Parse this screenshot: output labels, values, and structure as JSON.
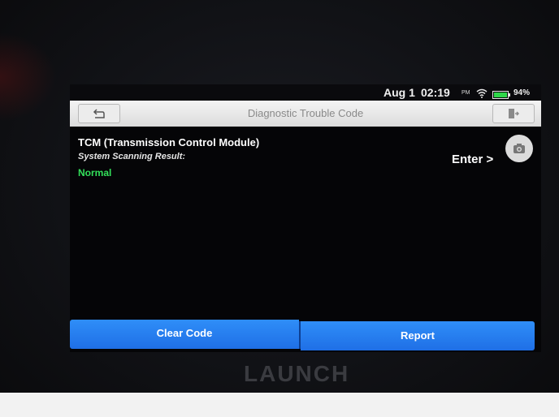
{
  "status_bar": {
    "date": "Aug 1",
    "time": "02:19",
    "ampm": "PM",
    "battery": "94%"
  },
  "header": {
    "title": "Diagnostic Trouble Code"
  },
  "module": {
    "name": "TCM (Transmission Control Module)",
    "scan_label": "System Scanning Result:",
    "status": "Normal",
    "enter_label": "Enter >"
  },
  "footer": {
    "clear_code_label": "Clear Code",
    "report_label": "Report"
  },
  "device": {
    "brand": "LAUNCH"
  },
  "colors": {
    "status_normal": "#33e05a",
    "button_blue": "#2f8ef8",
    "battery_green": "#2fd64a"
  },
  "icons": {
    "back": "back-arrow-icon",
    "exit": "exit-door-icon",
    "camera": "camera-icon",
    "wifi": "wifi-icon",
    "battery": "battery-icon"
  }
}
